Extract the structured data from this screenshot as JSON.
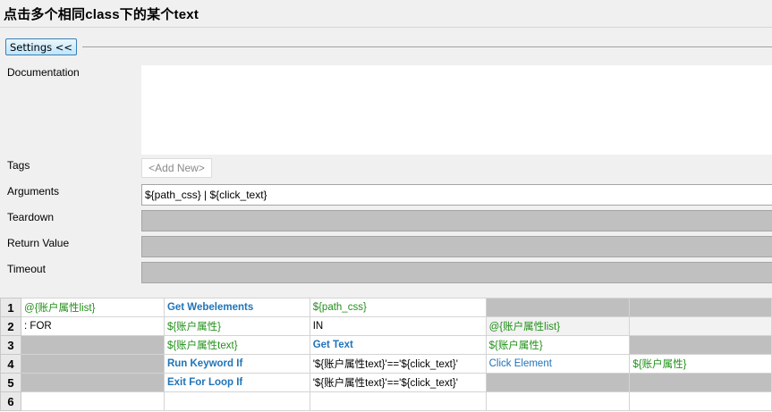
{
  "title": "点击多个相同class下的某个text",
  "settings_button": "Settings <<",
  "labels": {
    "documentation": "Documentation",
    "tags": "Tags",
    "arguments": "Arguments",
    "teardown": "Teardown",
    "return_value": "Return Value",
    "timeout": "Timeout"
  },
  "tags_placeholder": "<Add New>",
  "arguments_value": "${path_css} | ${click_text}",
  "grid": {
    "row_numbers": [
      "1",
      "2",
      "3",
      "4",
      "5",
      "6"
    ],
    "rows": [
      [
        "@{账户属性list}",
        "Get Webelements",
        "${path_css}",
        "",
        ""
      ],
      [
        ": FOR",
        "${账户属性}",
        "IN",
        "@{账户属性list}",
        ""
      ],
      [
        "",
        "${账户属性text}",
        "Get Text",
        "${账户属性}",
        ""
      ],
      [
        "",
        "Run Keyword If",
        "'${账户属性text}'=='${click_text}'",
        "Click Element",
        "${账户属性}"
      ],
      [
        "",
        "Exit For Loop If",
        "'${账户属性text}'=='${click_text}'",
        "",
        ""
      ],
      [
        "",
        "",
        "",
        "",
        ""
      ]
    ]
  }
}
